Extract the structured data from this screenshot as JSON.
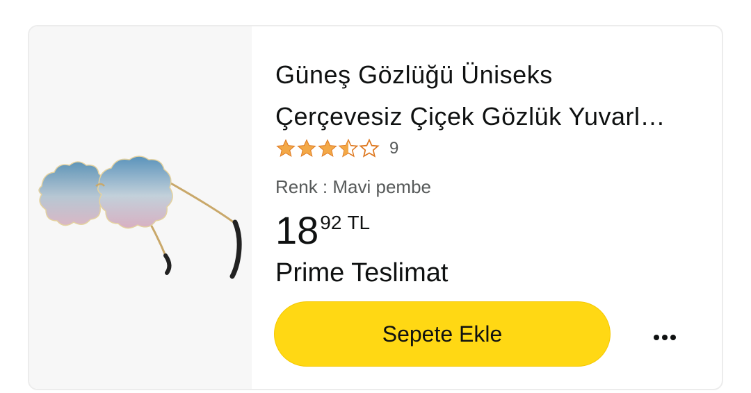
{
  "product": {
    "title_line1": "Güneş Gözlüğü Üniseks",
    "title_line2": "Çerçevesiz Çiçek Gözlük Yuvarl…",
    "rating": 3.5,
    "rating_max": 5,
    "rating_count": "9",
    "variant_label": "Renk : Mavi pembe",
    "price_whole": "18",
    "price_fraction": "92",
    "price_currency": "TL",
    "delivery": "Prime Teslimat",
    "image_icon": "sunglasses-image"
  },
  "actions": {
    "add_to_cart": "Sepete Ekle",
    "more_icon": "more-options-icon"
  },
  "colors": {
    "star": "#f3a847",
    "button": "#ffd814",
    "text_primary": "#0f1111",
    "text_secondary": "#565959",
    "image_bg": "#f7f7f7"
  }
}
